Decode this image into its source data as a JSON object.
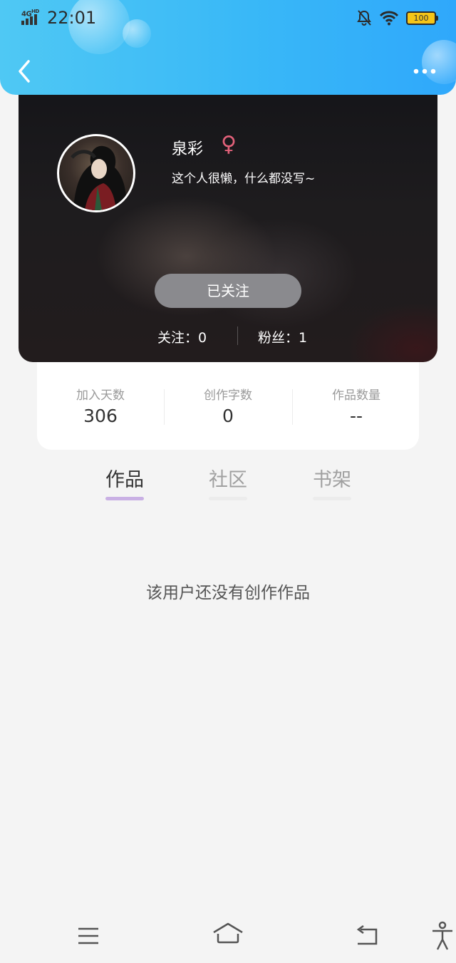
{
  "status_bar": {
    "network": "4G HD",
    "time": "22:01",
    "battery": "100"
  },
  "profile": {
    "username": "泉彩",
    "gender_symbol": "♀",
    "bio": "这个人很懒，什么都没写~",
    "follow_button_label": "已关注",
    "following": "关注：0",
    "followers": "粉丝：1"
  },
  "stats": [
    {
      "label": "加入天数",
      "value": "306"
    },
    {
      "label": "创作字数",
      "value": "0"
    },
    {
      "label": "作品数量",
      "value": "--"
    }
  ],
  "tabs": [
    {
      "label": "作品",
      "active": true
    },
    {
      "label": "社区",
      "active": false
    },
    {
      "label": "书架",
      "active": false
    }
  ],
  "empty_message": "该用户还没有创作作品",
  "colors": {
    "header_gradient_start": "#4fc8f4",
    "header_gradient_end": "#2fa8fb",
    "tab_indicator_active": "#c9b0e4",
    "gender_color": "#e2617a"
  },
  "icons": {
    "back": "chevron-left-icon",
    "more": "more-dots-icon",
    "mute": "bell-off-icon",
    "wifi": "wifi-icon",
    "menu": "menu-icon",
    "home": "home-icon",
    "return": "return-icon",
    "accessibility": "accessibility-icon"
  }
}
